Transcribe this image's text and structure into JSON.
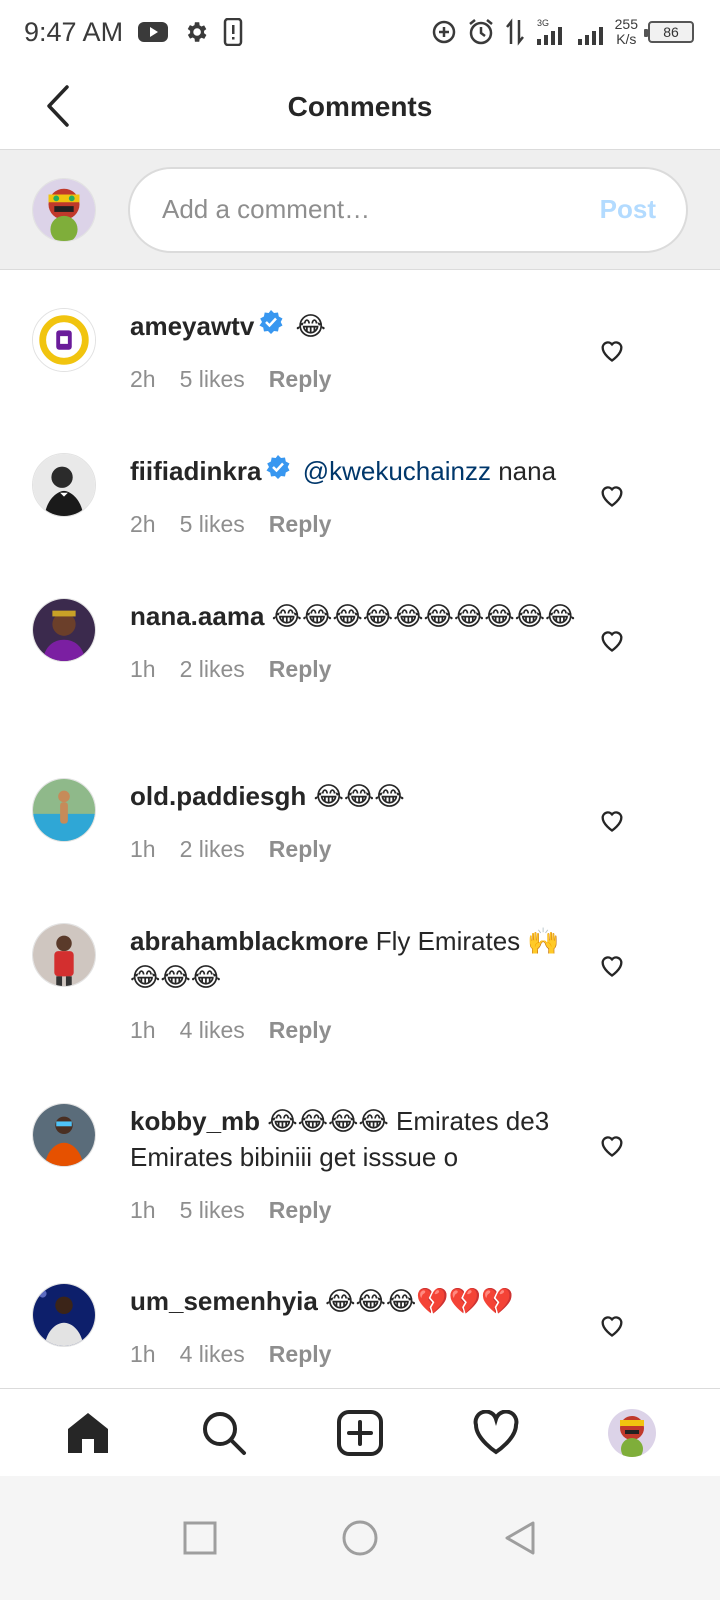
{
  "status_bar": {
    "time": "9:47 AM",
    "network": "3G",
    "speed_value": "255",
    "speed_unit": "K/s",
    "battery": "86"
  },
  "header": {
    "title": "Comments"
  },
  "composer": {
    "placeholder": "Add a comment…",
    "post_label": "Post"
  },
  "comments": [
    {
      "username": "ameyawtv",
      "verified": true,
      "mention": "",
      "text": "😂",
      "time": "2h",
      "likes": "5 likes",
      "reply": "Reply"
    },
    {
      "username": "fiifiadinkra",
      "verified": true,
      "mention": "@kwekuchainzz",
      "text": " nana",
      "time": "2h",
      "likes": "5 likes",
      "reply": "Reply"
    },
    {
      "username": "nana.aama",
      "verified": false,
      "mention": "",
      "text": "😂😂😂😂😂😂😂😂😂😂",
      "time": "1h",
      "likes": "2 likes",
      "reply": "Reply"
    },
    {
      "username": "old.paddiesgh",
      "verified": false,
      "mention": "",
      "text": "😂😂😂",
      "time": "1h",
      "likes": "2 likes",
      "reply": "Reply"
    },
    {
      "username": "abrahamblackmore",
      "verified": false,
      "mention": "",
      "text": "Fly Emirates 🙌😂😂😂",
      "time": "1h",
      "likes": "4 likes",
      "reply": "Reply"
    },
    {
      "username": "kobby_mb",
      "verified": false,
      "mention": "",
      "text": "😂😂😂😂 Emirates de3 Emirates bibiniii get isssue o",
      "time": "1h",
      "likes": "5 likes",
      "reply": "Reply"
    },
    {
      "username": "um_semenhyia",
      "verified": false,
      "mention": "",
      "text": "😂😂😂💔💔💔",
      "time": "1h",
      "likes": "4 likes",
      "reply": "Reply"
    }
  ],
  "icons": {
    "back": "arrow-left-icon",
    "verified": "verified-badge-icon",
    "like": "heart-outline-icon",
    "nav": [
      "home-icon",
      "search-icon",
      "add-post-icon",
      "activity-heart-icon",
      "profile-avatar"
    ],
    "system": [
      "recents-square-icon",
      "home-circle-icon",
      "back-triangle-icon"
    ]
  },
  "colors": {
    "mention": "#00376b",
    "verified": "#3897f0",
    "post_disabled": "#b3dbff",
    "meta_gray": "#8e8e8e"
  }
}
